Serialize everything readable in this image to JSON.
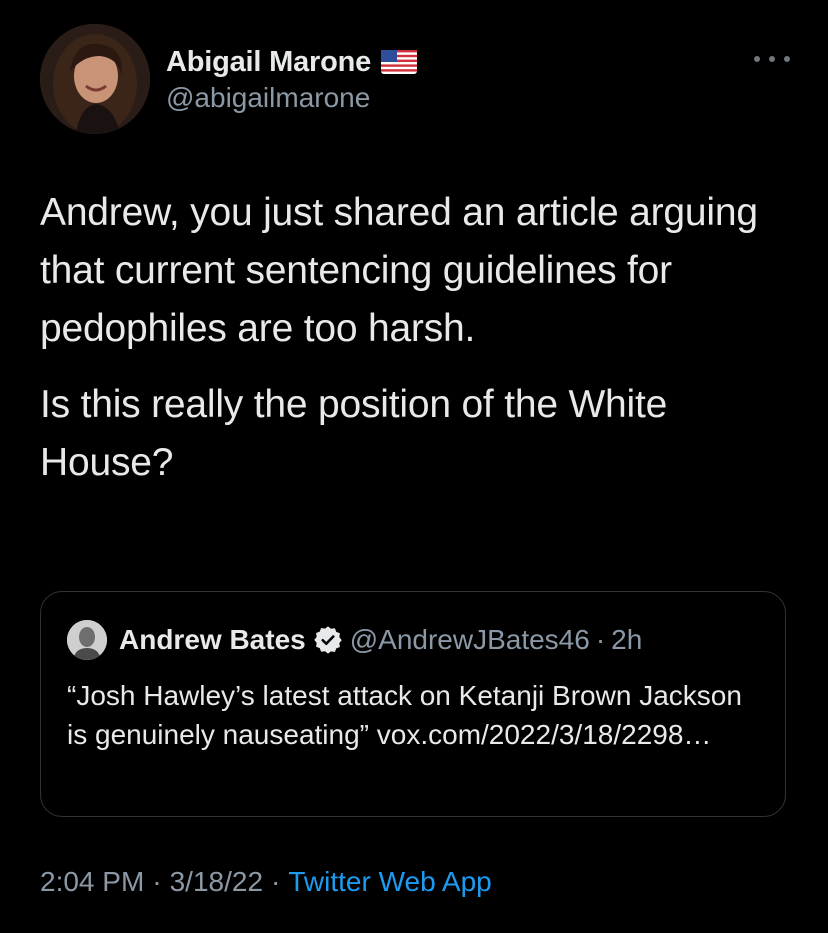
{
  "tweet": {
    "author": {
      "display_name": "Abigail Marone",
      "handle": "@abigailmarone",
      "flag_icon": "us-flag-emoji"
    },
    "text_paragraphs": [
      "Andrew, you just shared an article arguing that current sentencing guidelines for pedophiles are too harsh.",
      "Is this really the position of the White House?"
    ],
    "quoted": {
      "display_name": "Andrew Bates",
      "handle": "@AndrewJBates46",
      "separator": "·",
      "time": "2h",
      "verified_icon": "verified-badge-icon",
      "text": "“Josh Hawley’s latest attack on Ketanji Brown Jackson is genuinely nauseating” vox.com/2022/3/18/2298…"
    },
    "meta": {
      "time": "2:04 PM",
      "separator": "·",
      "date": "3/18/22",
      "source": "Twitter Web App"
    }
  },
  "colors": {
    "background": "#000000",
    "text": "#e7e9ea",
    "secondary": "#8b98a5",
    "link": "#1d9bf0",
    "border": "#2f3336"
  }
}
